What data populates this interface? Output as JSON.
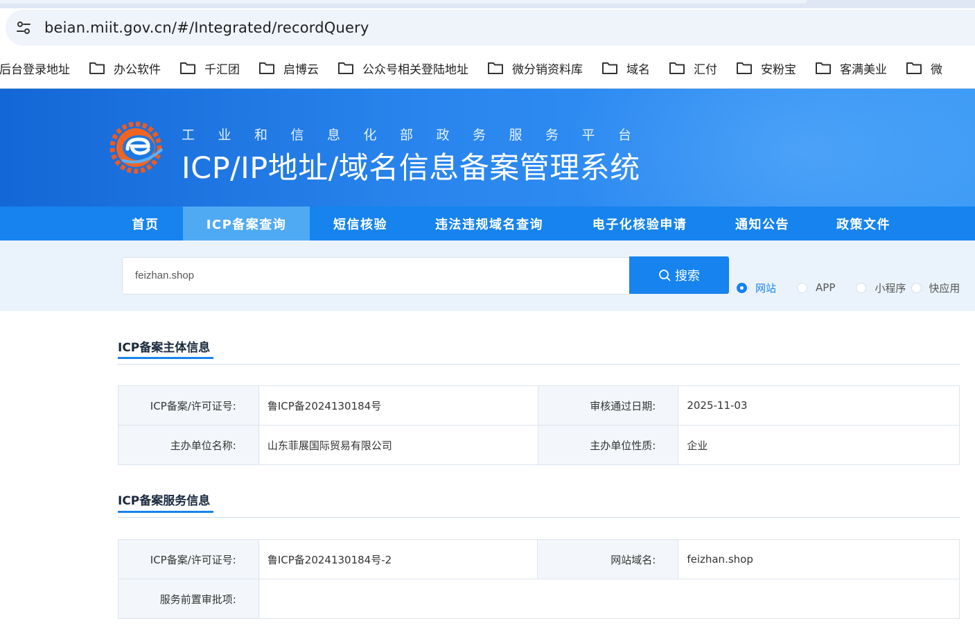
{
  "browser": {
    "url": "beian.miit.gov.cn/#/Integrated/recordQuery",
    "bookmarks": [
      "后台登录地址",
      "办公软件",
      "千汇团",
      "启博云",
      "公众号相关登陆地址",
      "微分销资料库",
      "域名",
      "汇付",
      "安粉宝",
      "客满美业",
      "微"
    ]
  },
  "header": {
    "subtitle": "工业和信息化部政务服务平台",
    "title": "ICP/IP地址/域名信息备案管理系统"
  },
  "nav": {
    "items": [
      "首页",
      "ICP备案查询",
      "短信核验",
      "违法违规域名查询",
      "电子化核验申请",
      "通知公告",
      "政策文件"
    ],
    "active": "ICP备案查询"
  },
  "search": {
    "value": "feizhan.shop",
    "button_label": "搜索",
    "types": [
      "网站",
      "APP",
      "小程序",
      "快应用"
    ],
    "selected_type": "网站"
  },
  "subject_info": {
    "title": "ICP备案主体信息",
    "rows": [
      {
        "label1": "ICP备案/许可证号:",
        "value1": "鲁ICP备2024130184号",
        "label2": "审核通过日期:",
        "value2": "2025-11-03"
      },
      {
        "label1": "主办单位名称:",
        "value1": "山东菲展国际贸易有限公司",
        "label2": "主办单位性质:",
        "value2": "企业"
      }
    ]
  },
  "service_info": {
    "title": "ICP备案服务信息",
    "rows": [
      {
        "label1": "ICP备案/许可证号:",
        "value1": "鲁ICP备2024130184号-2",
        "label2": "网站域名:",
        "value2": "feizhan.shop"
      },
      {
        "label1": "服务前置审批项:",
        "value1": ""
      }
    ]
  },
  "colors": {
    "primary": "#1683ee",
    "nav_active": "#50aaf3",
    "search_bg": "#eaf3fb",
    "label_bg": "#f3f7fb"
  }
}
